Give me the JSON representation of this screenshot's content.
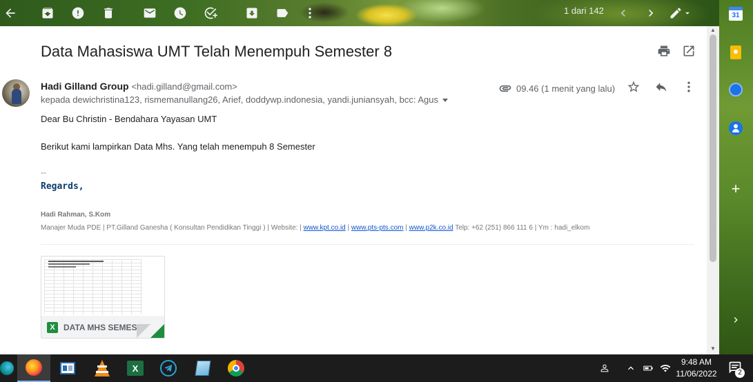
{
  "toolbar": {
    "pagination": "1 dari 142",
    "icons": [
      "back-arrow-icon",
      "archive-icon",
      "report-spam-icon",
      "delete-icon",
      "mark-unread-icon",
      "snooze-icon",
      "add-task-icon",
      "move-to-icon",
      "label-icon",
      "more-vert-icon",
      "chevron-left-icon",
      "chevron-right-icon",
      "pen-icon"
    ]
  },
  "email": {
    "subject": "Data Mahasiswa UMT Telah Menempuh Semester 8",
    "sender_name": "Hadi Gilland Group",
    "sender_email": "<hadi.gilland@gmail.com>",
    "recipients": "kepada dewichristina123, rismemanullang26, Arief, doddywp.indonesia, yandi.juniansyah, bcc: Agus",
    "time": "09.46 (1 menit yang lalu)",
    "greeting": "Dear Bu Christin - Bendahara Yayasan UMT",
    "message": "Berikut kami lampirkan Data Mhs. Yang telah menempuh 8 Semester",
    "signature": {
      "dash": "--",
      "regards": "Regards,",
      "name": "Hadi Rahman, S.Kom",
      "line_prefix": "Manajer Muda PDE | PT.Gilland Ganesha ( Konsultan Pendidikan Tinggi ) | Website: |",
      "link1": "www.kpt.co.id",
      "sep1": "|",
      "link2": "www.pts-pts.com",
      "sep2": "|",
      "link3": "www.p2k.co.id",
      "line_suffix": "Telp: +62 (251) 866 111 6 | Ym : hadi_elkom"
    },
    "attachment": {
      "name": "DATA MHS SEMES...",
      "type_badge": "X"
    }
  },
  "side_panel": {
    "calendar_label": "31"
  },
  "taskbar": {
    "time": "9:48 AM",
    "date": "11/06/2022",
    "notification_count": "2"
  }
}
